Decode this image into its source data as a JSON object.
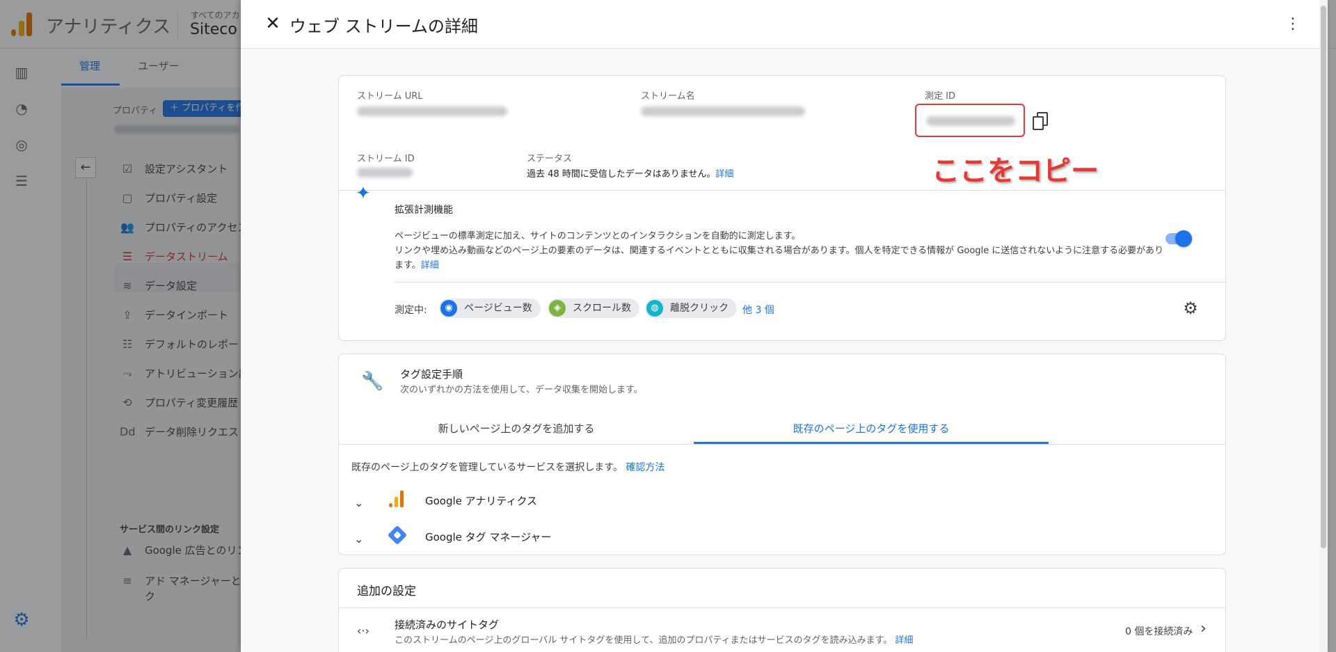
{
  "app": {
    "title": "アナリティクス",
    "account_top": "すべてのアカ",
    "account_name": "Siteco"
  },
  "admin": {
    "tabs": [
      "管理",
      "ユーザー"
    ],
    "property_label": "プロパティ",
    "create_property": "＋ プロパティを作成",
    "back_icon": "arrow-left-icon",
    "menu": [
      {
        "icon": "☑",
        "label": "設定アシスタント"
      },
      {
        "icon": "▢",
        "label": "プロパティ設定"
      },
      {
        "icon": "👥",
        "label": "プロパティのアクセス"
      },
      {
        "icon": "☰",
        "label": "データストリーム"
      },
      {
        "icon": "≋",
        "label": "データ設定"
      },
      {
        "icon": "⇪",
        "label": "データインポート"
      },
      {
        "icon": "☷",
        "label": "デフォルトのレポート"
      },
      {
        "icon": "⤳",
        "label": "アトリビューション設定"
      },
      {
        "icon": "⟲",
        "label": "プロパティ変更履歴"
      },
      {
        "icon": "Dd",
        "label": "データ削除リクエスト"
      }
    ],
    "section_title": "サービス間のリンク設定",
    "links": [
      {
        "icon": "▲",
        "label": "Google 広告とのリンク"
      },
      {
        "icon": "≡",
        "label": "アド マネージャーとのリン"
      },
      {
        "icon": "",
        "label": "ク"
      }
    ]
  },
  "drawer": {
    "title": "ウェブ ストリームの詳細",
    "details": {
      "stream_url_label": "ストリーム URL",
      "stream_name_label": "ストリーム名",
      "measurement_id_label": "測定 ID",
      "stream_id_label": "ストリーム ID",
      "status_label": "ステータス",
      "status_text": "過去 48 時間に受信したデータはありません。",
      "status_link": "詳細",
      "annotation": "ここをコピー"
    },
    "enhanced": {
      "title": "拡張計測機能",
      "desc1": "ページビューの標準測定に加え、サイトのコンテンツとのインタラクションを自動的に測定します。",
      "desc2": "リンクや埋め込み動画などのページ上の要素のデータは、関連するイベントとともに収集される場合があります。個人を特定できる情報が Google に送信されないように注意する必要があります。",
      "desc_link": "詳細",
      "measuring_label": "測定中:",
      "chips": [
        "ページビュー数",
        "スクロール数",
        "離脱クリック"
      ],
      "more": "他 3 個",
      "toggle_on": true
    },
    "tagging": {
      "title": "タグ設定手順",
      "subtitle": "次のいずれかの方法を使用して、データ収集を開始します。",
      "tabs": [
        "新しいページ上のタグを追加する",
        "既存のページ上のタグを使用する"
      ],
      "active_tab": 1,
      "select_text": "既存のページ上のタグを管理しているサービスを選択します。",
      "select_link": "確認方法",
      "services": [
        "Google アナリティクス",
        "Google タグ マネージャー"
      ]
    },
    "additional": {
      "title": "追加の設定",
      "connected_title": "接続済みのサイトタグ",
      "connected_desc": "このストリームのページ上のグローバル サイトタグを使用して、追加のプロパティまたはサービスのタグを読み込みます。",
      "connected_link": "詳細",
      "connected_count": "0 個を接続済み"
    }
  },
  "colors": {
    "accent": "#1a73e8",
    "annotation": "#e53935",
    "active_menu": "#d93025"
  }
}
